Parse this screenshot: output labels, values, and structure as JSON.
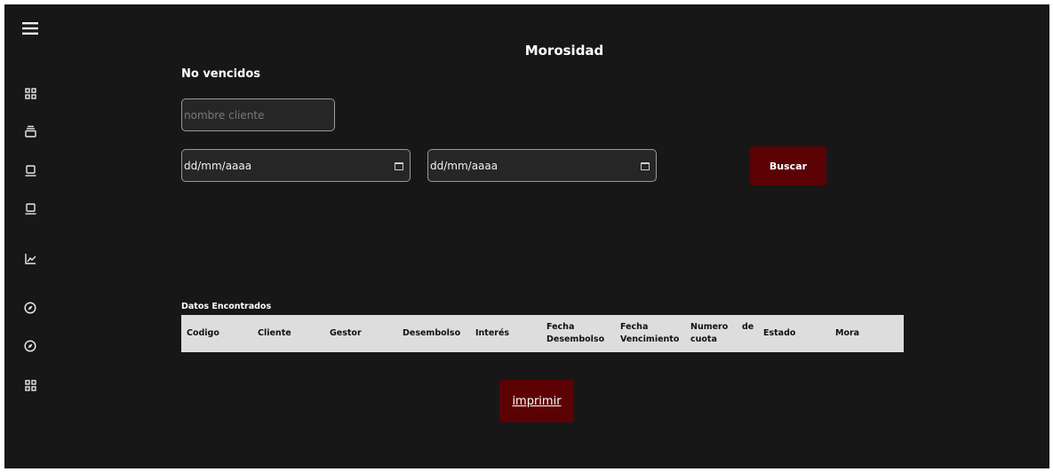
{
  "sidebar": {
    "icons": [
      {
        "name": "menu-icon"
      },
      {
        "name": "grid-icon"
      },
      {
        "name": "stack-icon"
      },
      {
        "name": "laptop-icon"
      },
      {
        "name": "laptop-icon"
      },
      {
        "name": "chart-line-icon"
      },
      {
        "name": "compass-icon"
      },
      {
        "name": "compass-icon"
      },
      {
        "name": "grid-icon"
      }
    ]
  },
  "page": {
    "title": "Morosidad",
    "subtitle": "No vencidos"
  },
  "filters": {
    "client_placeholder": "nombre cliente",
    "date_from": "dd/mm/aaaa",
    "date_to": "dd/mm/aaaa",
    "search_label": "Buscar"
  },
  "table": {
    "caption": "Datos Encontrados",
    "columns": {
      "codigo": "Codigo",
      "cliente": "Cliente",
      "gestor": "Gestor",
      "desembolso": "Desembolso",
      "interes": "Interés",
      "fecha_desembolso_1": "Fecha",
      "fecha_desembolso_2": "Desembolso",
      "fecha_vencimiento_1": "Fecha",
      "fecha_vencimiento_2": "Vencimiento",
      "numero_cuota_1": "Numero",
      "numero_cuota_de": "de",
      "numero_cuota_2": "cuota",
      "estado": "Estado",
      "mora": "Mora"
    }
  },
  "actions": {
    "print_label": "imprimir"
  },
  "colors": {
    "background": "#171718",
    "accent": "#5c0204",
    "table_header": "#dddddd"
  }
}
